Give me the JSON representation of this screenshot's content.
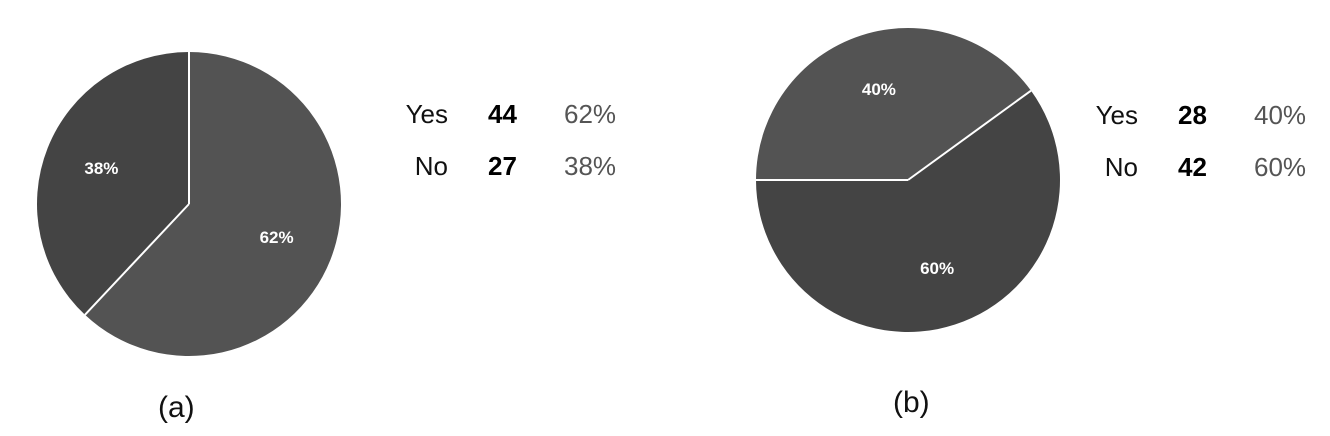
{
  "colors": {
    "slice_yes": "#535353",
    "slice_no": "#444444",
    "separator": "#ffffff",
    "label_text": "#ffffff"
  },
  "chart_data": [
    {
      "type": "pie",
      "caption": "(a)",
      "slices": [
        {
          "label": "Yes",
          "count": 44,
          "percent": 62,
          "slice_label": "62%"
        },
        {
          "label": "No",
          "count": 27,
          "percent": 38,
          "slice_label": "38%"
        }
      ],
      "legend_placement": "right",
      "legend": [
        {
          "label": "Yes",
          "count": "44",
          "percent": "62%"
        },
        {
          "label": "No",
          "count": "27",
          "percent": "38%"
        }
      ]
    },
    {
      "type": "pie",
      "caption": "(b)",
      "slices": [
        {
          "label": "Yes",
          "count": 28,
          "percent": 40,
          "slice_label": "40%"
        },
        {
          "label": "No",
          "count": 42,
          "percent": 60,
          "slice_label": "60%"
        }
      ],
      "legend_placement": "right",
      "legend": [
        {
          "label": "Yes",
          "count": "28",
          "percent": "40%"
        },
        {
          "label": "No",
          "count": "42",
          "percent": "60%"
        }
      ]
    }
  ]
}
